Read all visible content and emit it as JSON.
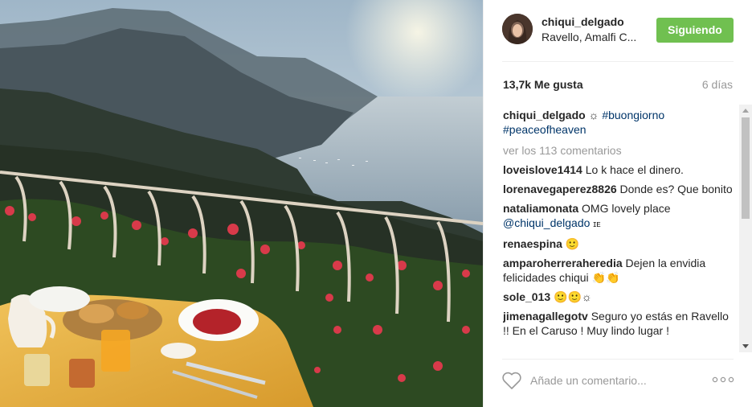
{
  "post": {
    "username": "chiqui_delgado",
    "location": "Ravello, Amalfi C...",
    "follow_label": "Siguiendo",
    "likes": "13,7k Me gusta",
    "time": "6 días",
    "view_comments": "ver los 113 comentarios",
    "comment_placeholder": "Añade un comentario..."
  },
  "caption": {
    "user": "chiqui_delgado",
    "emoji": "☼",
    "tag1": "#buongiorno",
    "tag2": "#peaceofheaven"
  },
  "comments": [
    {
      "user": "loveislove1414",
      "text": "Lo k hace el dinero."
    },
    {
      "user": "lorenavegaperez8826",
      "text": "Donde es? Que bonito"
    },
    {
      "user": "nataliamonata",
      "text": "OMG lovely place",
      "mention": "@chiqui_delgado",
      "after": "ɪᴇ"
    },
    {
      "user": "renaespina",
      "text": "🙂"
    },
    {
      "user": "amparoherreraheredia",
      "text": "Dejen la envidia felicidades chiqui 👏👏"
    },
    {
      "user": "sole_013",
      "text": "🙂🙂☼"
    },
    {
      "user": "jimenagallegotv",
      "text": "Seguro yo estás en Ravello !! En el Caruso ! Muy lindo lugar !"
    }
  ],
  "icons": {
    "avatar": "avatar",
    "heart": "heart-outline-icon",
    "more": "more-options-icon"
  },
  "colors": {
    "follow_button": "#70c050",
    "link": "#003569",
    "muted": "#999999"
  }
}
